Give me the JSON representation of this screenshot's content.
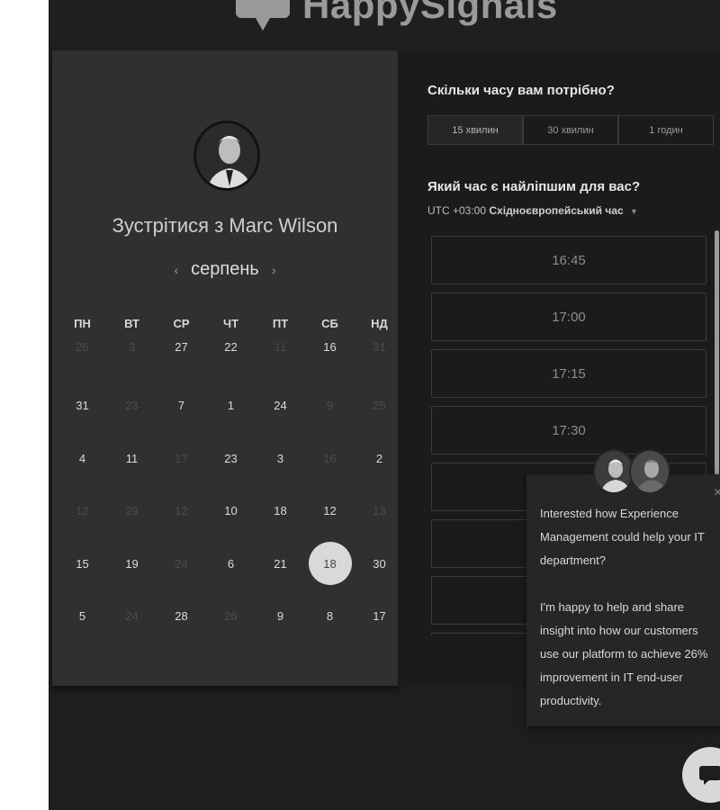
{
  "brand": {
    "name": "HappySignals"
  },
  "profile": {
    "meet_prefix": "Зустрітися з",
    "host_name": "Marc Wilson"
  },
  "calendar": {
    "month": "серпень",
    "prev_icon": "chevron-left-icon",
    "next_icon": "chevron-right-icon",
    "weekdays": [
      "ПН",
      "ВТ",
      "СР",
      "ЧТ",
      "ПТ",
      "СБ",
      "НД"
    ],
    "rows": [
      [
        {
          "d": "26",
          "m": true
        },
        {
          "d": "3",
          "m": true
        },
        {
          "d": "27",
          "m": false
        },
        {
          "d": "22",
          "m": false
        },
        {
          "d": "11",
          "m": true
        },
        {
          "d": "16",
          "m": false
        },
        {
          "d": "31",
          "m": true
        }
      ],
      [
        {
          "d": "31",
          "m": false
        },
        {
          "d": "23",
          "m": true
        },
        {
          "d": "7",
          "m": false
        },
        {
          "d": "1",
          "m": false
        },
        {
          "d": "24",
          "m": false
        },
        {
          "d": "9",
          "m": true
        },
        {
          "d": "25",
          "m": true
        }
      ],
      [
        {
          "d": "4",
          "m": false
        },
        {
          "d": "11",
          "m": false
        },
        {
          "d": "17",
          "m": true
        },
        {
          "d": "23",
          "m": false
        },
        {
          "d": "3",
          "m": false
        },
        {
          "d": "16",
          "m": true
        },
        {
          "d": "2",
          "m": false
        }
      ],
      [
        {
          "d": "12",
          "m": true
        },
        {
          "d": "29",
          "m": true
        },
        {
          "d": "12",
          "m": true
        },
        {
          "d": "10",
          "m": false
        },
        {
          "d": "18",
          "m": false
        },
        {
          "d": "12",
          "m": false
        },
        {
          "d": "13",
          "m": true
        }
      ],
      [
        {
          "d": "15",
          "m": false
        },
        {
          "d": "19",
          "m": false
        },
        {
          "d": "24",
          "m": true
        },
        {
          "d": "6",
          "m": false
        },
        {
          "d": "21",
          "m": false
        },
        {
          "d": "18",
          "m": false,
          "selected": true
        },
        {
          "d": "30",
          "m": false
        }
      ],
      [
        {
          "d": "5",
          "m": false
        },
        {
          "d": "24",
          "m": true
        },
        {
          "d": "28",
          "m": false
        },
        {
          "d": "26",
          "m": true
        },
        {
          "d": "9",
          "m": false
        },
        {
          "d": "8",
          "m": false
        },
        {
          "d": "17",
          "m": false
        }
      ]
    ]
  },
  "booking": {
    "duration_question": "Скільки часу вам потрібно?",
    "durations": [
      "15 хвилин",
      "30 хвилин",
      "1 годин"
    ],
    "active_duration": "15 хвилин",
    "time_question": "Який час є найліпшим для вас?",
    "tz_offset": "UTC +03:00",
    "tz_name": "Східноєвропейський час",
    "slots": [
      "16:45",
      "17:00",
      "17:15",
      "17:30",
      "",
      "",
      "",
      ""
    ]
  },
  "chat_popup": {
    "close_icon": "close-icon",
    "message": "Interested how Experience Management could help your IT department?\n\nI'm happy to help and share insight into how our customers use our platform to achieve 26% improvement in IT end-user productivity."
  },
  "chat_button": {
    "icon": "chat-bubble-icon"
  },
  "colors": {
    "page_bg": "#1e1e1e",
    "panel_left": "#303030",
    "panel_right": "#1b1b1b",
    "selected_day": "#d9d9d9"
  }
}
